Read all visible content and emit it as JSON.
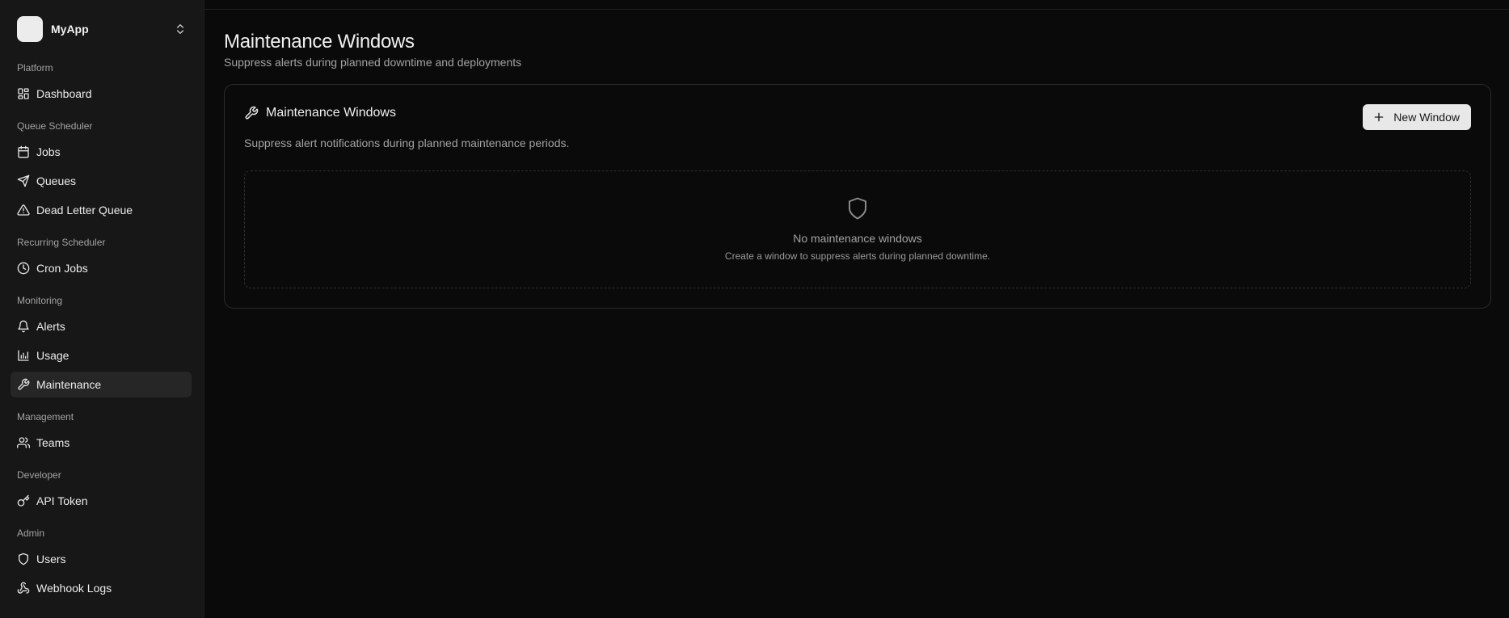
{
  "app": {
    "name": "MyApp"
  },
  "sidebar": {
    "groups": [
      {
        "label": "Platform",
        "items": [
          {
            "label": "Dashboard",
            "icon": "grid-icon"
          }
        ]
      },
      {
        "label": "Queue Scheduler",
        "items": [
          {
            "label": "Jobs",
            "icon": "calendar-icon"
          },
          {
            "label": "Queues",
            "icon": "send-icon"
          },
          {
            "label": "Dead Letter Queue",
            "icon": "alert-triangle-icon"
          }
        ]
      },
      {
        "label": "Recurring Scheduler",
        "items": [
          {
            "label": "Cron Jobs",
            "icon": "clock-icon"
          }
        ]
      },
      {
        "label": "Monitoring",
        "items": [
          {
            "label": "Alerts",
            "icon": "bell-icon"
          },
          {
            "label": "Usage",
            "icon": "bar-chart-icon"
          },
          {
            "label": "Maintenance",
            "icon": "wrench-icon",
            "active": true
          }
        ]
      },
      {
        "label": "Management",
        "items": [
          {
            "label": "Teams",
            "icon": "users-icon"
          }
        ]
      },
      {
        "label": "Developer",
        "items": [
          {
            "label": "API Token",
            "icon": "key-icon"
          }
        ]
      },
      {
        "label": "Admin",
        "items": [
          {
            "label": "Users",
            "icon": "shield-icon"
          },
          {
            "label": "Webhook Logs",
            "icon": "webhook-icon"
          }
        ]
      }
    ]
  },
  "page": {
    "title": "Maintenance Windows",
    "subtitle": "Suppress alerts during planned downtime and deployments"
  },
  "card": {
    "title": "Maintenance Windows",
    "description": "Suppress alert notifications during planned maintenance periods.",
    "new_button_label": "New Window",
    "empty_title": "No maintenance windows",
    "empty_description": "Create a window to suppress alerts during planned downtime."
  },
  "colors": {
    "background": "#0a0a0a",
    "sidebar": "#171717",
    "active_item": "#262626",
    "button": "#e8e8e8"
  }
}
